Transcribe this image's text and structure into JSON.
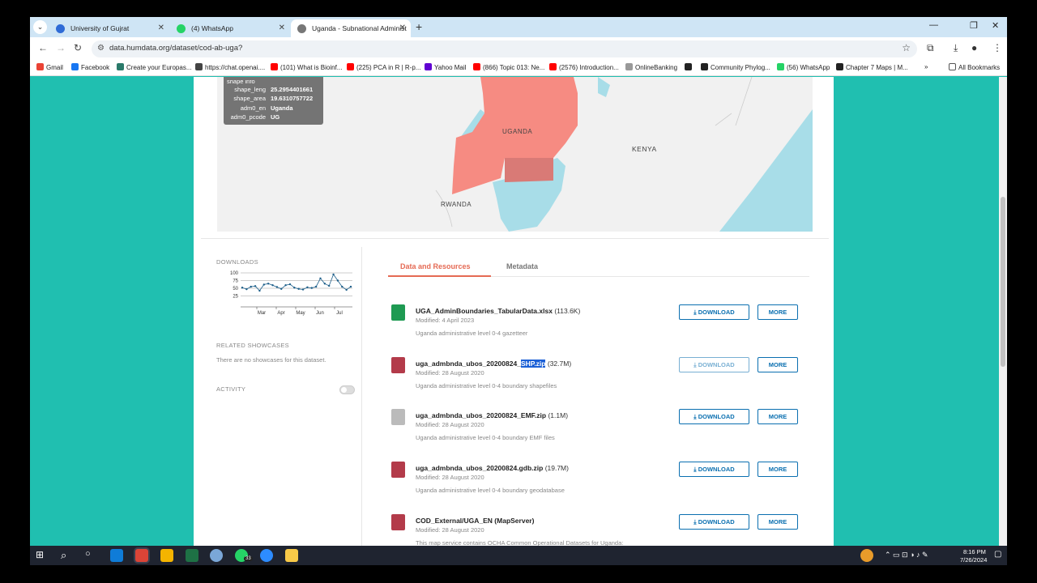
{
  "browser": {
    "tabs": [
      {
        "title": "University of Gujrat",
        "color": "#2f6bd6"
      },
      {
        "title": "(4) WhatsApp",
        "color": "#25d366"
      },
      {
        "title": "Uganda - Subnational Administ",
        "color": "#555555"
      }
    ],
    "url": "data.humdata.org/dataset/cod-ab-uga?",
    "bookmarks": [
      {
        "label": "Gmail",
        "color": "#ea4335"
      },
      {
        "label": "Facebook",
        "color": "#1877f2"
      },
      {
        "label": "Create your Europas...",
        "color": "#2a7a6a"
      },
      {
        "label": "https://chat.openai....",
        "color": "#444444"
      },
      {
        "label": "(101) What is Bioinf...",
        "color": "#ff0000"
      },
      {
        "label": "(225) PCA in R | R-p...",
        "color": "#ff0000"
      },
      {
        "label": "Yahoo Mail",
        "color": "#6001d2"
      },
      {
        "label": "(866) Topic 013: Ne...",
        "color": "#ff0000"
      },
      {
        "label": "(2576) Introduction...",
        "color": "#ff0000"
      },
      {
        "label": "OnlineBanking",
        "color": "#999999"
      },
      {
        "label": "",
        "color": "#222222"
      },
      {
        "label": "Community Phylog...",
        "color": "#222222"
      },
      {
        "label": "(56) WhatsApp",
        "color": "#25d366"
      },
      {
        "label": "Chapter 7 Maps | M...",
        "color": "#222222"
      }
    ],
    "all_bookmarks": "All Bookmarks"
  },
  "map": {
    "popup_title": "shape info",
    "popup_rows": [
      {
        "k": "shape_leng",
        "v": "25.2954401661"
      },
      {
        "k": "shape_area",
        "v": "19.6310757722"
      },
      {
        "k": "adm0_en",
        "v": "Uganda"
      },
      {
        "k": "adm0_pcode",
        "v": "UG"
      }
    ],
    "labels": {
      "uganda": "UGANDA",
      "kenya": "KENYA",
      "rwanda": "RWANDA"
    },
    "colors": {
      "land": "#f1f1f1",
      "water": "#a8dde8",
      "uganda": "#f68b82",
      "uganda_dark": "#d97a76"
    }
  },
  "sidebar": {
    "downloads_heading": "DOWNLOADS",
    "related_heading": "RELATED SHOWCASES",
    "related_text": "There are no showcases for this dataset.",
    "activity_heading": "ACTIVITY"
  },
  "chart_data": {
    "type": "line",
    "x": [
      "",
      "",
      "",
      "",
      "",
      "",
      "",
      "",
      "",
      "",
      "",
      "",
      "",
      "",
      "",
      "",
      "",
      "",
      "",
      "",
      "",
      "",
      "",
      "",
      "",
      ""
    ],
    "series": [
      {
        "values": [
          52,
          47,
          55,
          57,
          42,
          62,
          65,
          60,
          54,
          48,
          60,
          63,
          52,
          48,
          46,
          53,
          51,
          55,
          82,
          65,
          58,
          95,
          75,
          55,
          45,
          55
        ]
      }
    ],
    "categories_ticks": [
      "Mar",
      "Apr",
      "May",
      "Jun",
      "Jul"
    ],
    "y_ticks": [
      "100",
      "75",
      "50",
      "25"
    ],
    "ylim": [
      0,
      100
    ],
    "grid": true,
    "line_color": "#1d5f8a"
  },
  "tabs": {
    "data": "Data and Resources",
    "metadata": "Metadata",
    "accent": "#e56a54"
  },
  "resources": [
    {
      "name": "UGA_AdminBoundaries_TabularData.xlsx",
      "name_hl": "",
      "size": "(113.6K)",
      "modified": "Modified: 4 April 2023",
      "desc": "Uganda administrative level 0-4 gazetteer",
      "icon": "xlsx-icon",
      "icon_color": "#1e9a52"
    },
    {
      "name": "uga_admbnda_ubos_20200824_",
      "name_hl": "SHP.zip",
      "size": "(32.7M)",
      "modified": "Modified: 28 August 2020",
      "desc": "Uganda administrative level 0-4 boundary shapefiles",
      "icon": "shp-icon",
      "icon_color": "#b33b4a"
    },
    {
      "name": "uga_admbnda_ubos_20200824_EMF.zip",
      "name_hl": "",
      "size": "(1.1M)",
      "modified": "Modified: 28 August 2020",
      "desc": "Uganda administrative level 0-4 boundary EMF files",
      "icon": "emf-icon",
      "icon_color": "#bbbbbb"
    },
    {
      "name": "uga_admbnda_ubos_20200824.gdb.zip",
      "name_hl": "",
      "size": "(19.7M)",
      "modified": "Modified: 28 August 2020",
      "desc": "Uganda administrative level 0-4 boundary geodatabase",
      "icon": "gdb-icon",
      "icon_color": "#b33b4a"
    },
    {
      "name": "COD_External/UGA_EN (MapServer)",
      "name_hl": "",
      "size": "",
      "modified": "Modified: 28 August 2020",
      "desc": "This map service contains OCHA Common Operational Datasets for Uganda:",
      "icon": "mapserver-icon",
      "icon_color": "#b33b4a"
    }
  ],
  "buttons": {
    "download": "DOWNLOAD",
    "more": "MORE"
  },
  "taskbar": {
    "time": "8:16 PM",
    "date": "7/26/2024",
    "badge": "33"
  }
}
